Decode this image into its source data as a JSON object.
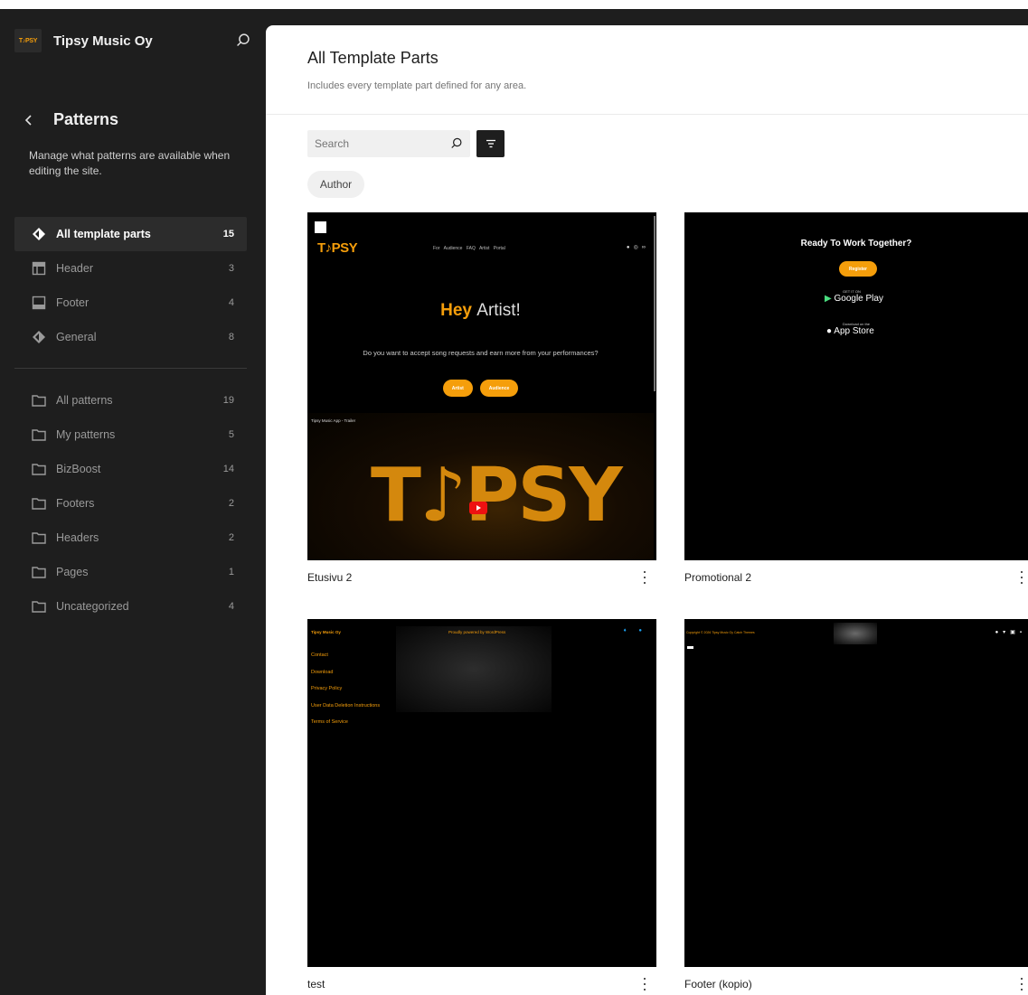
{
  "site": {
    "name": "Tipsy Music Oy",
    "logo_text": "T♪PSY"
  },
  "panel": {
    "title": "Patterns",
    "description": "Manage what patterns are available when editing the site."
  },
  "template_nav": [
    {
      "label": "All template parts",
      "count": "15",
      "icon": "diamond-icon"
    },
    {
      "label": "Header",
      "count": "3",
      "icon": "header-icon"
    },
    {
      "label": "Footer",
      "count": "4",
      "icon": "footer-icon"
    },
    {
      "label": "General",
      "count": "8",
      "icon": "diamond-icon"
    }
  ],
  "pattern_nav": [
    {
      "label": "All patterns",
      "count": "19",
      "icon": "folder-icon"
    },
    {
      "label": "My patterns",
      "count": "5",
      "icon": "folder-icon"
    },
    {
      "label": "BizBoost",
      "count": "14",
      "icon": "folder-icon"
    },
    {
      "label": "Footers",
      "count": "2",
      "icon": "folder-icon"
    },
    {
      "label": "Headers",
      "count": "2",
      "icon": "folder-icon"
    },
    {
      "label": "Pages",
      "count": "1",
      "icon": "folder-icon"
    },
    {
      "label": "Uncategorized",
      "count": "4",
      "icon": "folder-icon"
    }
  ],
  "main": {
    "title": "All Template Parts",
    "description": "Includes every template part defined for any area.",
    "search_placeholder": "Search",
    "author_filter": "Author"
  },
  "cards": [
    {
      "title": "Etusivu 2",
      "preview": {
        "logo": "T♪PSY",
        "nav": "For Audience   FAQ   Artist Portal",
        "social": "●◎∞",
        "heading_a": "Hey",
        "heading_b": "Artist!",
        "text": "Do you want to accept song requests and earn more from your performances?",
        "btn1": "Artist",
        "btn2": "Audience",
        "video_title": "Tipsy Music App - Trailer",
        "video_logo": "T♪PSY"
      }
    },
    {
      "title": "Promotional 2",
      "preview": {
        "heading": "Ready To Work Together?",
        "register": "Register",
        "gp_small": "GET IT ON",
        "gp": "Google Play",
        "as_small": "Download on the",
        "as": "App Store"
      }
    },
    {
      "title": "test",
      "preview": {
        "brand": "Tipsy Music Oy",
        "powered": "Proudly powered by WordPress",
        "links": [
          "Contact",
          "Download",
          "Privacy Policy",
          "User Data Deletion Instructions",
          "Terms of Service"
        ]
      }
    },
    {
      "title": "Footer (kopio)",
      "preview": {
        "copy": "Copyright © 2026 Tipsy Music Oy Catch Themes",
        "social": "●▾▣▪"
      }
    }
  ],
  "colors": {
    "accent": "#f59e0b",
    "sidebar_bg": "#1e1e1e",
    "active_bg": "#2c2c2c"
  }
}
